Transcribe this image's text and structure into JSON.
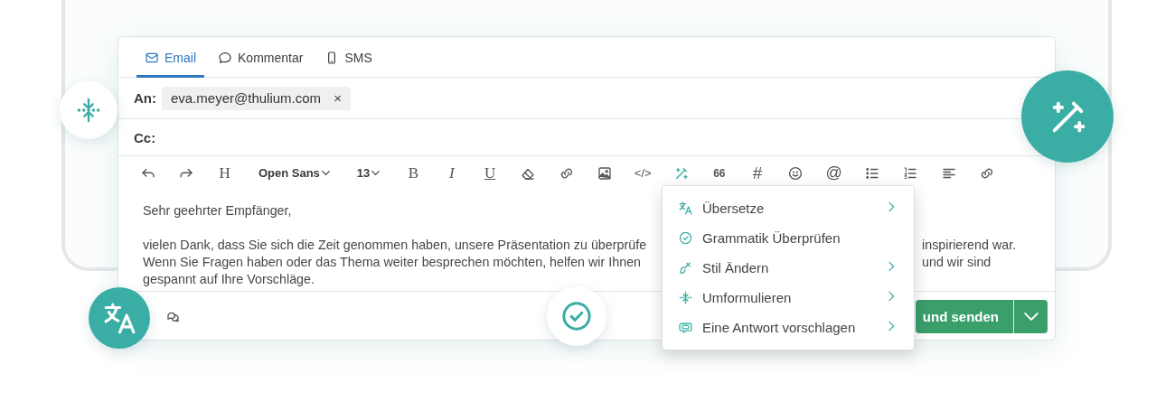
{
  "tabs": [
    {
      "label": "Email",
      "selected": true
    },
    {
      "label": "Kommentar",
      "selected": false
    },
    {
      "label": "SMS",
      "selected": false
    }
  ],
  "to": {
    "label": "An:",
    "chips": [
      {
        "address": "eva.meyer@thulium.com",
        "remove": "×"
      }
    ]
  },
  "cc": {
    "label": "Cc:"
  },
  "toolbar": {
    "heading": "H",
    "font": "Open Sans",
    "size": "13",
    "bold": "B",
    "italic": "I",
    "underline": "U",
    "code": "</>",
    "quote": "66",
    "hashtag": "#",
    "mention": "@"
  },
  "body": {
    "greeting": "Sehr geehrter Empfänger,",
    "lines": [
      {
        "start": "vielen Dank, dass Sie sich die Zeit genommen haben, unsere Präsentation zu überprüfe",
        "end": "inspirierend war."
      },
      {
        "start": "Wenn Sie Fragen haben oder das Thema weiter besprechen möchten, helfen wir Ihnen",
        "end": "und wir sind"
      },
      {
        "start": "gespannt auf Ihre Vorschläge."
      }
    ]
  },
  "send_button": {
    "label": "und senden"
  },
  "ai_menu": [
    {
      "label": "Übersetze",
      "submenu": true
    },
    {
      "label": "Grammatik Überprüfen",
      "submenu": false
    },
    {
      "label": "Stil Ändern",
      "submenu": true
    },
    {
      "label": "Umformulieren",
      "submenu": true
    },
    {
      "label": "Eine Antwort vorschlagen",
      "submenu": true
    }
  ]
}
